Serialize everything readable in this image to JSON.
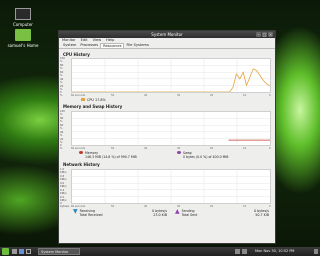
{
  "desktop": {
    "icons": [
      {
        "label": "Computer",
        "icon": "monitor-icon"
      },
      {
        "label": "samuel's Home",
        "icon": "folder-icon"
      }
    ]
  },
  "window": {
    "title": "System Monitor",
    "menu": [
      "Monitor",
      "Edit",
      "View",
      "Help"
    ],
    "tabs": [
      "System",
      "Processes",
      "Resources",
      "File Systems"
    ],
    "active_tab": "Resources",
    "cpu": {
      "title": "CPU History",
      "yticks": [
        "100 %",
        "80 %",
        "60 %",
        "40 %",
        "20 %",
        "0 %"
      ],
      "x_left": "60 seconds",
      "x_mid": [
        "50",
        "40",
        "30",
        "20",
        "10"
      ],
      "x_right": "0",
      "legend": "CPU  17.8%",
      "color": "#e6a23c"
    },
    "memory": {
      "title": "Memory and Swap History",
      "yticks": [
        "100 %",
        "80 %",
        "60 %",
        "40 %",
        "20 %",
        "0 %"
      ],
      "x_left": "60 seconds",
      "x_mid": [
        "50",
        "40",
        "30",
        "20",
        "10"
      ],
      "x_right": "0",
      "mem_label": "Memory",
      "mem_value": "146.3 MiB (14.8 %) of 990.7 MiB",
      "mem_color": "#c0392b",
      "swap_label": "Swap",
      "swap_value": "0 bytes (0.0 %) of 400.0 MiB",
      "swap_color": "#8e44ad"
    },
    "network": {
      "title": "Network History",
      "yticks": [
        "1.0 KiB/s",
        "0.8 KiB/s",
        "0.6 KiB/s",
        "0.4 KiB/s",
        "0.2 KiB/s",
        "0 bytes/s"
      ],
      "x_left": "60 seconds",
      "x_mid": [
        "50",
        "40",
        "30",
        "20",
        "10"
      ],
      "x_right": "0",
      "recv_label": "Receiving",
      "recv_rate": "0 bytes/s",
      "recv_total_label": "Total Received",
      "recv_total": "23.0 KiB",
      "recv_color": "#2e86c1",
      "send_label": "Sending",
      "send_rate": "0 bytes/s",
      "send_total_label": "Total Sent",
      "send_total": "50.7 KiB",
      "send_color": "#8e44ad"
    },
    "cpu_series": [
      0,
      0,
      0,
      0,
      0,
      0,
      0,
      0,
      0,
      0,
      0,
      0,
      0,
      0,
      0,
      0,
      0,
      0,
      0,
      0,
      0,
      0,
      0,
      0,
      0,
      0,
      0,
      0,
      0,
      0,
      0,
      0,
      0,
      0,
      0,
      0,
      0,
      0,
      0,
      0,
      0,
      0,
      0,
      0,
      0,
      0,
      0,
      0,
      15,
      55,
      40,
      60,
      20,
      45,
      70,
      65,
      50,
      35,
      25,
      18
    ],
    "mem_series_value": 14.8
  },
  "taskbar": {
    "task_label": "System Monitor",
    "clock": "Mon Nov 30, 10:52 PM"
  }
}
